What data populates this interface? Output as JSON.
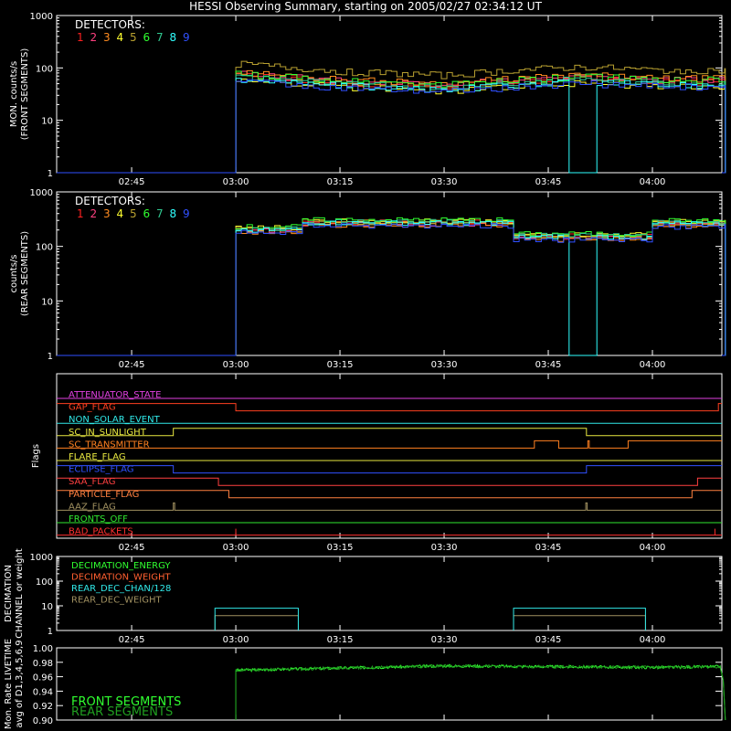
{
  "title": "HESSI Observing Summary, starting on 2005/02/27 02:34:12 UT",
  "colors": {
    "d1": "#ff2020",
    "d2": "#ff4080",
    "d3": "#ff8c20",
    "d4": "#ffff30",
    "d5": "#b8a030",
    "d6": "#30ff30",
    "d7": "#30c890",
    "d8": "#30ffff",
    "d9": "#3050ff",
    "axis": "#ffffff",
    "front_green": "#30ff30",
    "rear_green": "#20a020"
  },
  "x_time_ticks": [
    "02:45",
    "03:00",
    "03:15",
    "03:30",
    "03:45",
    "04:00"
  ],
  "x_time_ticks_minutes": [
    165,
    180,
    195,
    210,
    225,
    240
  ],
  "x_range_minutes": [
    154.2,
    250
  ],
  "chart_data": [
    {
      "type": "line",
      "id": "front",
      "ylabel_1": "MON. counts/s",
      "ylabel_2": "(FRONT SEGMENTS)",
      "yscale": "log",
      "ylim": [
        1,
        1000
      ],
      "yticks": [
        "1",
        "10",
        "100",
        "1000"
      ],
      "legend_title": "DETECTORS:",
      "legend_numbers": [
        "1",
        "2",
        "3",
        "4",
        "5",
        "6",
        "7",
        "8",
        "9"
      ],
      "on_minutes": [
        180,
        250.5
      ],
      "start_val": 110,
      "series": [
        {
          "name": "1",
          "color_key": "d1",
          "base": 58
        },
        {
          "name": "2",
          "color_key": "d2",
          "base": 62
        },
        {
          "name": "3",
          "color_key": "d3",
          "base": 66
        },
        {
          "name": "4",
          "color_key": "d4",
          "base": 48
        },
        {
          "name": "5",
          "color_key": "d5",
          "base": 95
        },
        {
          "name": "6",
          "color_key": "d6",
          "base": 62
        },
        {
          "name": "7",
          "color_key": "d7",
          "base": 55
        },
        {
          "name": "8",
          "color_key": "d8",
          "base": 50
        },
        {
          "name": "9",
          "color_key": "d9",
          "base": 46
        }
      ],
      "profile_minutes": [
        180,
        195,
        210,
        220,
        230,
        240,
        250
      ],
      "profile_factor": [
        1.25,
        0.9,
        0.75,
        0.95,
        1.1,
        0.95,
        0.95
      ],
      "dropout": {
        "detector": "8",
        "minutes": [
          227.5,
          232
        ]
      }
    },
    {
      "type": "line",
      "id": "rear",
      "ylabel_1": "counts/s",
      "ylabel_2": "(REAR SEGMENTS)",
      "yscale": "log",
      "ylim": [
        1,
        1000
      ],
      "yticks": [
        "1",
        "10",
        "100",
        "1000"
      ],
      "legend_title": "DETECTORS:",
      "legend_numbers": [
        "1",
        "2",
        "3",
        "4",
        "5",
        "6",
        "7",
        "8",
        "9"
      ],
      "on_minutes": [
        180,
        250.5
      ],
      "levels": [
        {
          "minutes": [
            180,
            189
          ],
          "value": 210
        },
        {
          "minutes": [
            189,
            220
          ],
          "value": 280
        },
        {
          "minutes": [
            220,
            240
          ],
          "value": 155
        },
        {
          "minutes": [
            240,
            250.5
          ],
          "value": 270
        }
      ],
      "series": [
        {
          "name": "1",
          "color_key": "d1",
          "factor": 1.0
        },
        {
          "name": "2",
          "color_key": "d2",
          "factor": 0.93
        },
        {
          "name": "3",
          "color_key": "d3",
          "factor": 0.88
        },
        {
          "name": "4",
          "color_key": "d4",
          "factor": 1.05
        },
        {
          "name": "5",
          "color_key": "d5",
          "factor": 0.97
        },
        {
          "name": "6",
          "color_key": "d6",
          "factor": 1.1
        },
        {
          "name": "7",
          "color_key": "d7",
          "factor": 1.02
        },
        {
          "name": "8",
          "color_key": "d8",
          "factor": 0.96
        },
        {
          "name": "9",
          "color_key": "d9",
          "factor": 0.85
        }
      ],
      "dropout": {
        "detector": "8",
        "minutes": [
          227.5,
          232
        ]
      }
    },
    {
      "type": "line",
      "id": "flags",
      "ylabel": "Flags",
      "flags": [
        {
          "name": "ATTENUATOR_STATE",
          "color": "#e040e0",
          "high": false,
          "toggles": []
        },
        {
          "name": "GAP_FLAG",
          "color": "#ff4020",
          "high": true,
          "toggles": [
            180,
            249.5
          ]
        },
        {
          "name": "NON_SOLAR_EVENT",
          "color": "#30e8e8",
          "high": false,
          "toggles": []
        },
        {
          "name": "SC_IN_SUNLIGHT",
          "color": "#e8e840",
          "high": false,
          "toggles": [
            171,
            230.5
          ]
        },
        {
          "name": "SC_TRANSMITTER",
          "color": "#ff8020",
          "high": false,
          "toggles": [
            223,
            226.5,
            230.7,
            230.9,
            236.5
          ]
        },
        {
          "name": "FLARE_FLAG",
          "color": "#e8e840",
          "high": false,
          "toggles": []
        },
        {
          "name": "ECLIPSE_FLAG",
          "color": "#3050ff",
          "high": true,
          "toggles": [
            171,
            230.5
          ]
        },
        {
          "name": "SAA_FLAG",
          "color": "#ff4040",
          "high": true,
          "toggles": [
            177.5,
            246.5
          ]
        },
        {
          "name": "PARTICLE_FLAG",
          "color": "#ff8040",
          "high": true,
          "toggles": [
            179,
            245.7
          ]
        },
        {
          "name": "AAZ_FLAG",
          "color": "#a09060",
          "high": false,
          "toggles": [
            171,
            171.2,
            230.4,
            230.6
          ]
        },
        {
          "name": "FRONTS_OFF",
          "color": "#30e830",
          "high": false,
          "toggles": []
        },
        {
          "name": "BAD_PACKETS",
          "color": "#ff3030",
          "high": false,
          "toggles": []
        }
      ],
      "bad_packet_spikes_minutes": [
        180,
        249
      ]
    },
    {
      "type": "line",
      "id": "decimation",
      "ylabel_1": "DECIMATION",
      "ylabel_2": "CHANNEL or weight",
      "yscale": "log",
      "ylim": [
        1,
        1000
      ],
      "yticks": [
        "1",
        "10",
        "100",
        "1000"
      ],
      "legend": [
        {
          "name": "DECIMATION_ENERGY",
          "color": "#30ff30"
        },
        {
          "name": "DECIMATION_WEIGHT",
          "color": "#ff6030"
        },
        {
          "name": "REAR_DEC_CHAN/128",
          "color": "#30e8e8"
        },
        {
          "name": "REAR_DEC_WEIGHT",
          "color": "#a09060"
        }
      ],
      "rear_dec_chan_segments": [
        {
          "minutes": [
            177,
            189
          ],
          "value": 8
        },
        {
          "minutes": [
            220,
            239
          ],
          "value": 8
        }
      ],
      "rear_dec_weight_segments": [
        {
          "minutes": [
            177,
            189
          ],
          "value": 4
        },
        {
          "minutes": [
            220,
            239
          ],
          "value": 4
        }
      ]
    },
    {
      "type": "line",
      "id": "livetime",
      "ylabel_1": "Mon. Rate LIVETIME",
      "ylabel_2": "avg of D1,3,4,5,6,9",
      "ylim": [
        0.9,
        1.0
      ],
      "yticks": [
        "0.90",
        "0.92",
        "0.94",
        "0.96",
        "0.98",
        "1.00"
      ],
      "legend": [
        {
          "name": "FRONT SEGMENTS",
          "color": "#30ff30"
        },
        {
          "name": "REAR SEGMENTS",
          "color": "#20a020"
        }
      ],
      "on_minutes": [
        180,
        250.5
      ],
      "profile_minutes": [
        180,
        195,
        210,
        225,
        240,
        250
      ],
      "profile_values": [
        0.969,
        0.972,
        0.975,
        0.974,
        0.973,
        0.974
      ]
    }
  ]
}
